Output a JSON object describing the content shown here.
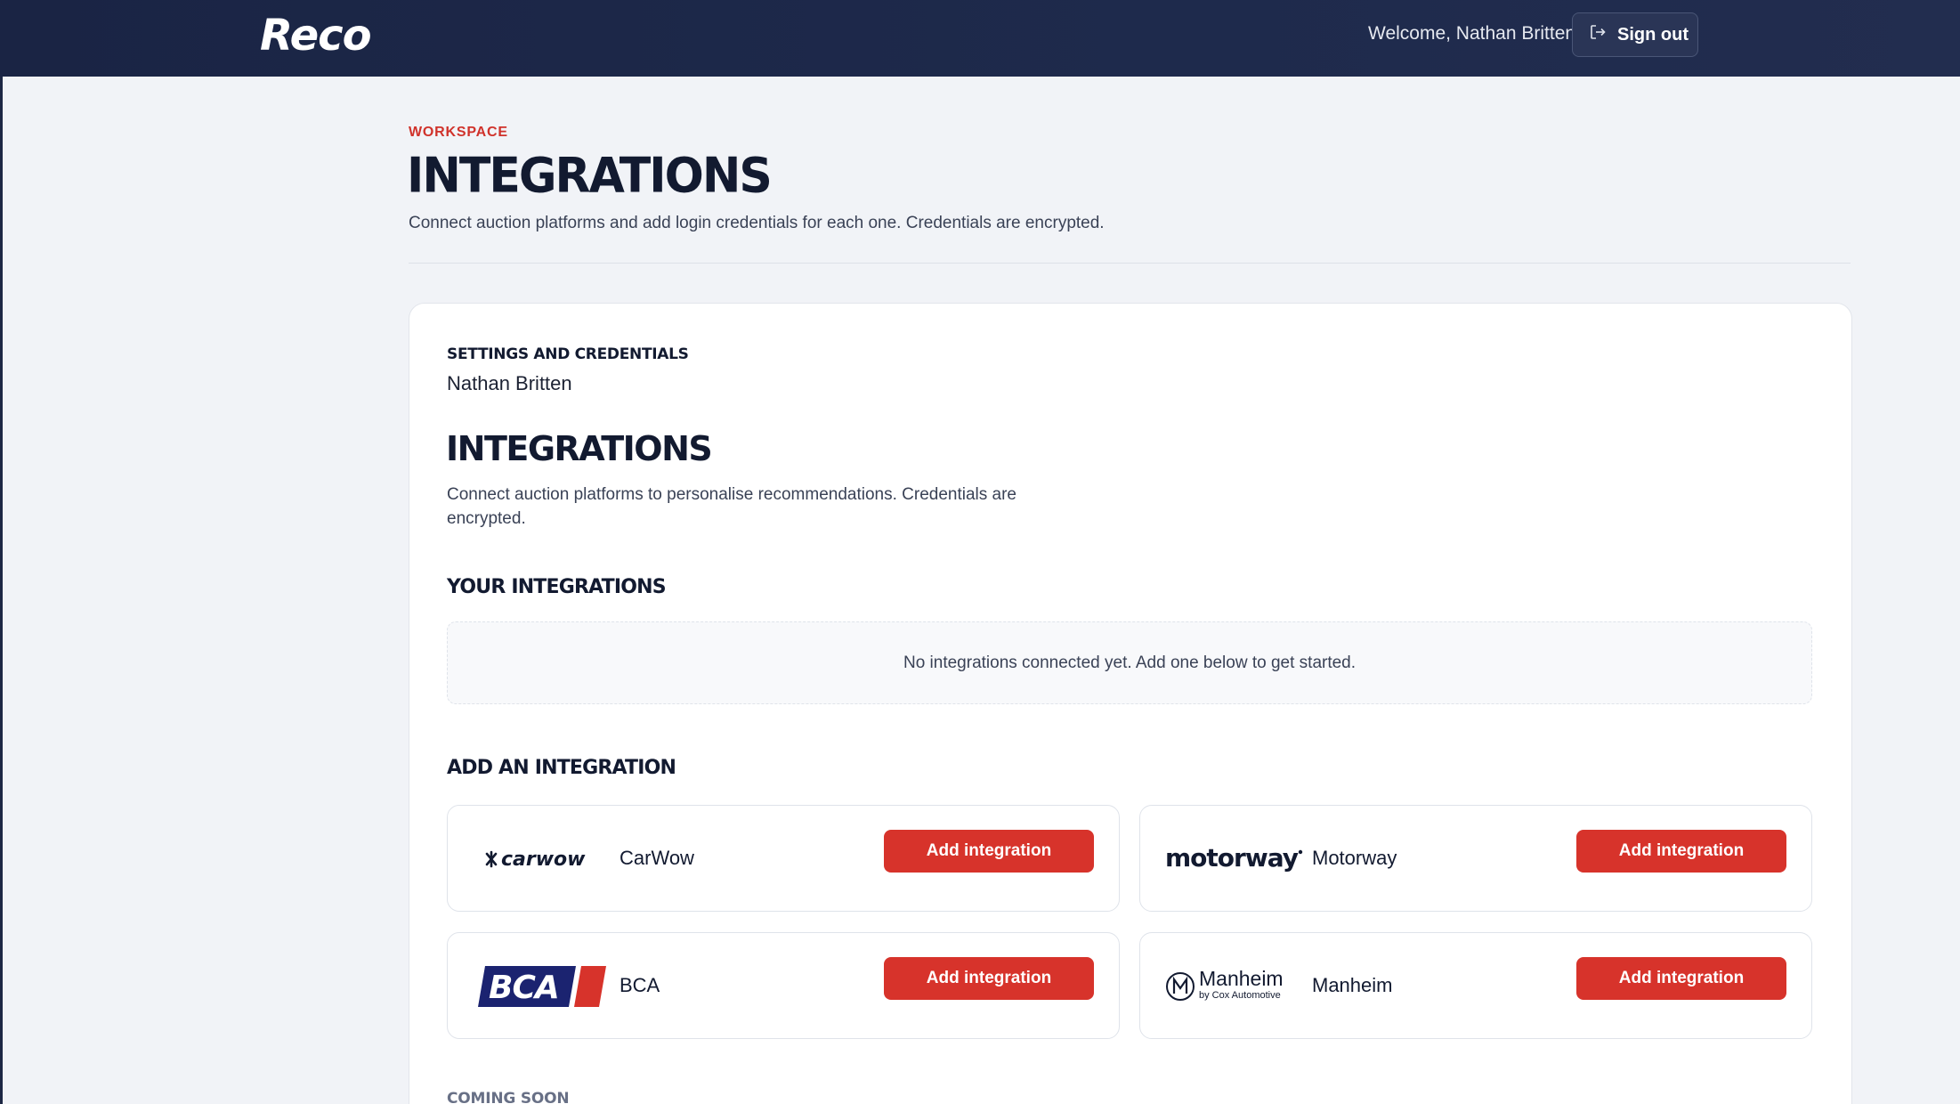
{
  "header": {
    "logo_text": "Reco",
    "welcome_text": "Welcome, Nathan Britten",
    "signout_label": "Sign out"
  },
  "page": {
    "eyebrow": "WORKSPACE",
    "title": "INTEGRATIONS",
    "subtitle": "Connect auction platforms and add login credentials for each one. Credentials are encrypted."
  },
  "card": {
    "settings_label": "SETTINGS AND CREDENTIALS",
    "user_name": "Nathan Britten",
    "section_title": "INTEGRATIONS",
    "section_desc": "Connect auction platforms to personalise recommendations. Credentials are encrypted.",
    "your_integrations_heading": "YOUR INTEGRATIONS",
    "empty_message": "No integrations connected yet. Add one below to get started.",
    "add_heading": "ADD AN INTEGRATION",
    "coming_soon_heading": "COMING SOON"
  },
  "integrations": [
    {
      "name": "CarWow",
      "logo_text": "carwow",
      "button_label": "Add integration"
    },
    {
      "name": "Motorway",
      "logo_text": "motorway",
      "button_label": "Add integration"
    },
    {
      "name": "BCA",
      "logo_text": "BCA",
      "button_label": "Add integration"
    },
    {
      "name": "Manheim",
      "logo_text": "Manheim",
      "logo_subtext": "by Cox Automotive",
      "button_label": "Add integration"
    }
  ],
  "colors": {
    "header_bg": "#1e2a4c",
    "accent_red": "#d7332b",
    "page_bg": "#f1f3f7",
    "bca_navy": "#1b2370"
  }
}
